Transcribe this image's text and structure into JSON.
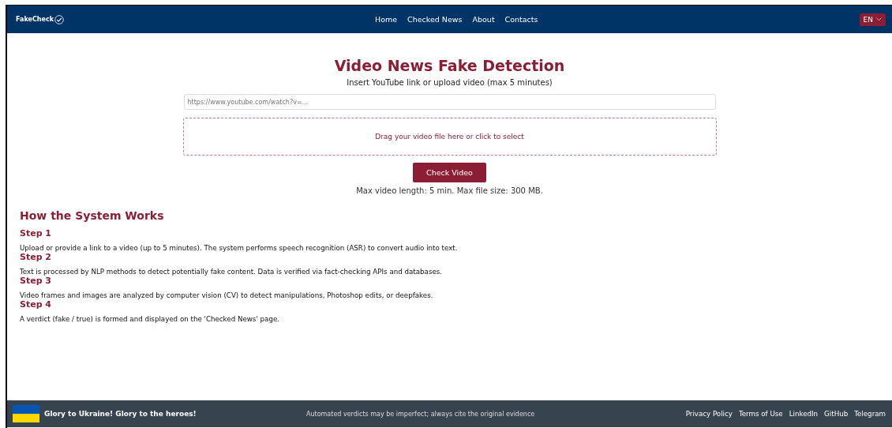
{
  "navbar": {
    "logo": "FakeCheck",
    "links": [
      {
        "label": "Home"
      },
      {
        "label": "Checked News"
      },
      {
        "label": "About"
      },
      {
        "label": "Contacts"
      }
    ],
    "language": "EN"
  },
  "hero": {
    "title": "Video News Fake Detection",
    "subtitle": "Insert YouTube link or upload video (max 5 minutes)",
    "url_field": {
      "placeholder": "https://www.youtube.com/watch?v=..."
    },
    "drop_zone": "Drag your video file here or click to select",
    "button": "Check Video",
    "limits": "Max video length: 5 min. Max file size: 300 MB."
  },
  "how_it_works": {
    "title": "How the System Works",
    "steps": [
      {
        "title": "Step 1",
        "text": "Upload or provide a link to a video (up to 5 minutes). The system performs speech recognition (ASR) to convert audio into text."
      },
      {
        "title": "Step 2",
        "text": "Text is processed by NLP methods to detect potentially fake content. Data is verified via fact-checking APIs and databases."
      },
      {
        "title": "Step 3",
        "text": "Video frames and images are analyzed by computer vision (CV) to detect manipulations, Photoshop edits, or deepfakes."
      },
      {
        "title": "Step 4",
        "text": "A verdict (fake / true) is formed and displayed on the 'Checked News' page."
      }
    ]
  },
  "footer": {
    "slogan": "Glory to Ukraine! Glory to the heroes!",
    "notice": "Automated verdicts may be imperfect; always cite the original evidence",
    "links": [
      {
        "label": "Privacy Policy"
      },
      {
        "label": "Terms of Use"
      },
      {
        "label": "LinkedIn"
      },
      {
        "label": "GitHub"
      },
      {
        "label": "Telegram"
      }
    ]
  }
}
